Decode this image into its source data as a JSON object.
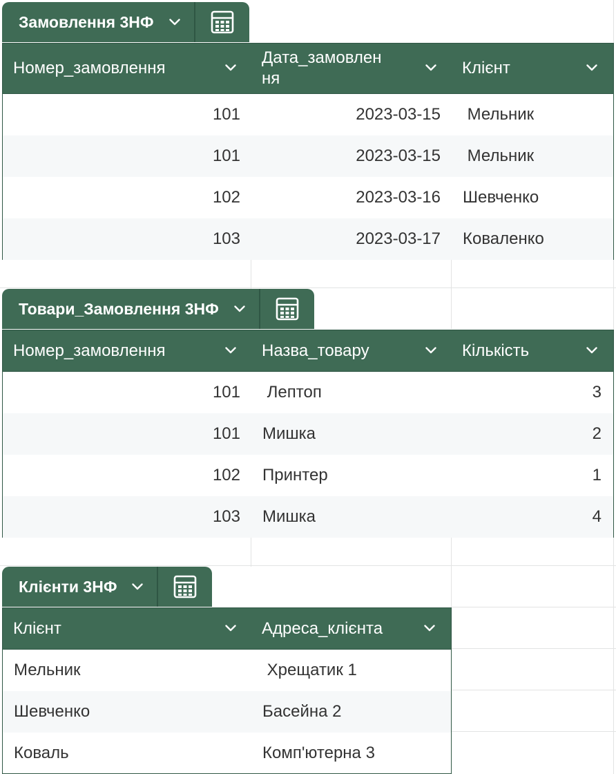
{
  "tables": [
    {
      "name": "Замовлення 3НФ",
      "columns": [
        {
          "label": "Номер_замовлення"
        },
        {
          "label": "Дата_замовлен\nня"
        },
        {
          "label": "Клієнт"
        }
      ],
      "rows": [
        [
          "101",
          "2023-03-15",
          " Мельник"
        ],
        [
          "101",
          "2023-03-15",
          " Мельник"
        ],
        [
          "102",
          "2023-03-16",
          "Шевченко"
        ],
        [
          "103",
          "2023-03-17",
          "Коваленко"
        ]
      ]
    },
    {
      "name": "Товари_Замовлення 3НФ",
      "columns": [
        {
          "label": "Номер_замовлення"
        },
        {
          "label": "Назва_товару"
        },
        {
          "label": "Кількість"
        }
      ],
      "rows": [
        [
          "101",
          " Лептоп",
          "3"
        ],
        [
          "101",
          "Мишка",
          "2"
        ],
        [
          "102",
          "Принтер",
          "1"
        ],
        [
          "103",
          "Мишка",
          "4"
        ]
      ]
    },
    {
      "name": "Клієнти 3НФ",
      "columns": [
        {
          "label": "Клієнт"
        },
        {
          "label": "Адреса_клієнта"
        }
      ],
      "rows": [
        [
          "Мельник",
          " Хрещатик 1"
        ],
        [
          "Шевченко",
          "Басейна 2"
        ],
        [
          "Коваль",
          "Комп'ютерна 3"
        ]
      ]
    }
  ],
  "icons": {
    "dropdown": "chevron-down-icon",
    "calculator": "calculator-icon"
  },
  "colors": {
    "header_green": "#3f6b55",
    "header_border": "#2f5644",
    "alt_row": "#f6f8f9",
    "grid_line": "#e2e3e3"
  }
}
